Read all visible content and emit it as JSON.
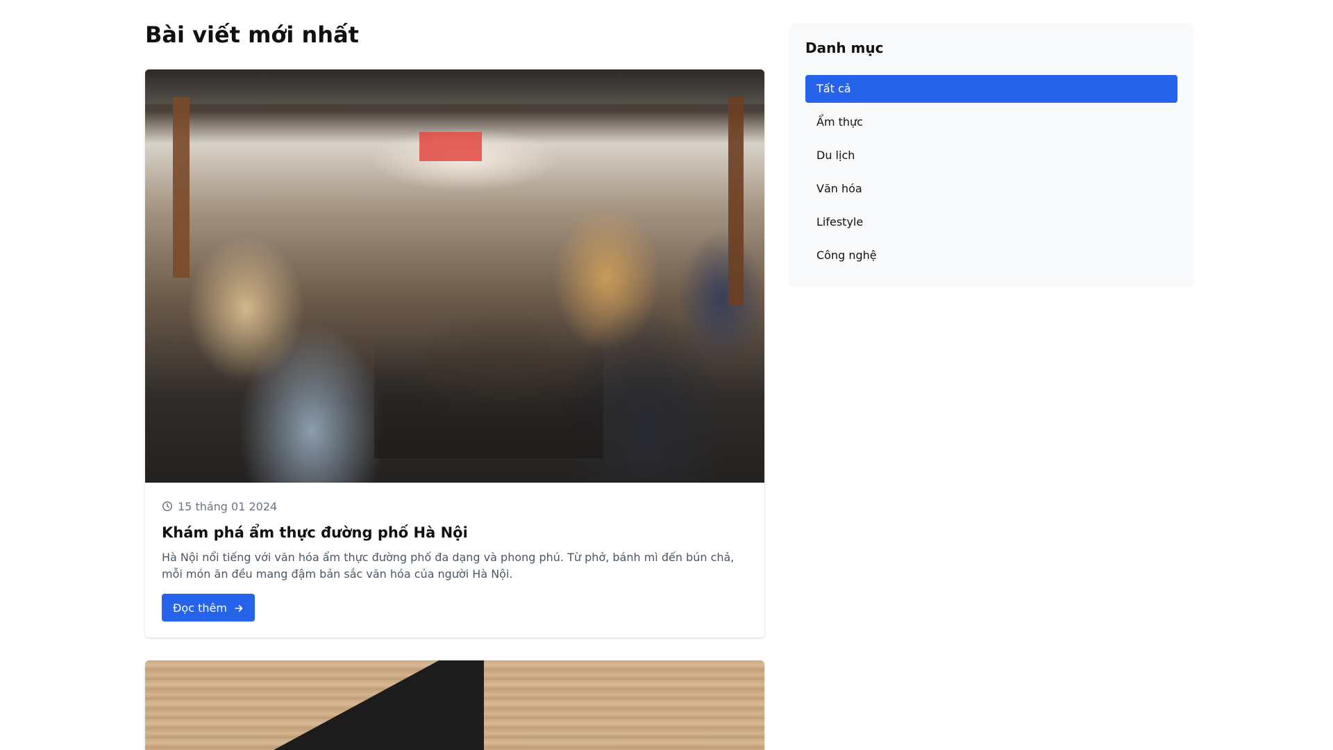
{
  "main": {
    "title": "Bài viết mới nhất",
    "posts": [
      {
        "image": "outdoor-dining-photo",
        "date": "15 tháng 01 2024",
        "title": "Khám phá ẩm thực đường phố Hà Nội",
        "excerpt": "Hà Nội nổi tiếng với văn hóa ẩm thực đường phố đa dạng và phong phú. Từ phở, bánh mì đến bún chả, mỗi món ăn đều mang đậm bản sắc văn hóa của người Hà Nội.",
        "read_more_label": "Đọc thêm"
      },
      {
        "image": "laptop-on-wood-table-photo"
      }
    ]
  },
  "sidebar": {
    "title": "Danh mục",
    "categories": [
      {
        "label": "Tất cả",
        "active": true
      },
      {
        "label": "Ẩm thực",
        "active": false
      },
      {
        "label": "Du lịch",
        "active": false
      },
      {
        "label": "Văn hóa",
        "active": false
      },
      {
        "label": "Lifestyle",
        "active": false
      },
      {
        "label": "Công nghệ",
        "active": false
      }
    ]
  },
  "colors": {
    "accent": "#2563eb",
    "sidebar_bg": "#f8f9fb",
    "muted_text": "#6b7280"
  },
  "icons": {
    "date": "clock-icon",
    "read_more": "arrow-right-icon"
  }
}
